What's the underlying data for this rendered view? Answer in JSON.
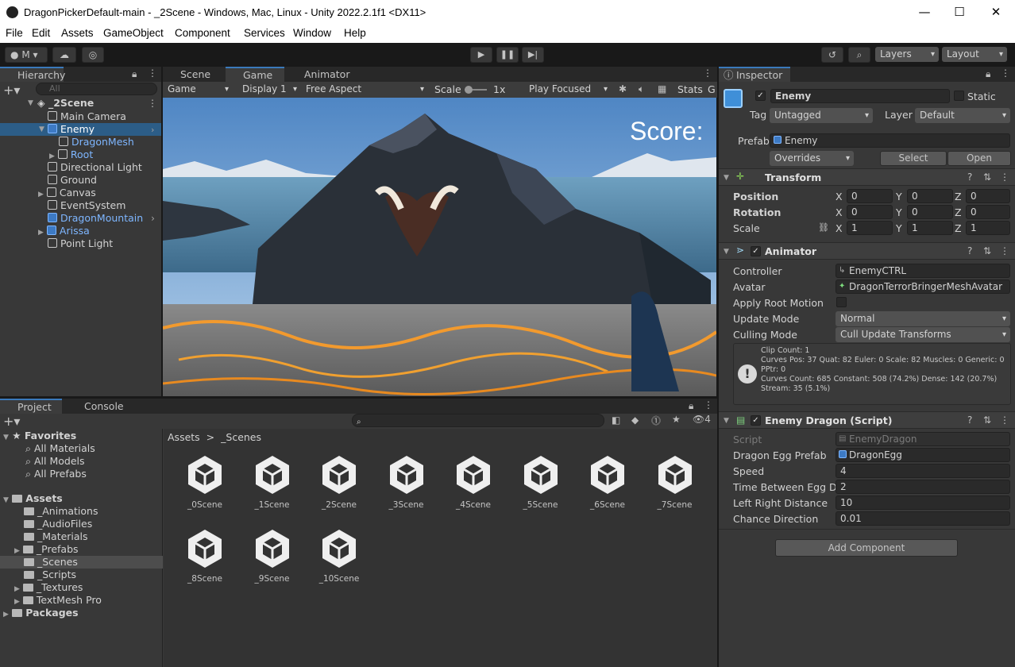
{
  "window": {
    "title": "DragonPickerDefault-main - _2Scene - Windows, Mac, Linux - Unity 2022.2.1f1 <DX11>",
    "minimize": "—",
    "maximize": "☐",
    "close": "✕"
  },
  "menu": [
    "File",
    "Edit",
    "Assets",
    "GameObject",
    "Component",
    "Services",
    "Window",
    "Help"
  ],
  "toolbar": {
    "account": "M",
    "layers": "Layers",
    "layout": "Layout"
  },
  "hierarchy": {
    "tab": "Hierarchy",
    "search_placeholder": "All",
    "scene": "_2Scene",
    "items": [
      {
        "label": "Main Camera"
      },
      {
        "label": "Enemy"
      },
      {
        "label": "DragonMesh"
      },
      {
        "label": "Root"
      },
      {
        "label": "Directional Light"
      },
      {
        "label": "Ground"
      },
      {
        "label": "Canvas"
      },
      {
        "label": "EventSystem"
      },
      {
        "label": "DragonMountain"
      },
      {
        "label": "Arissa"
      },
      {
        "label": "Point Light"
      }
    ]
  },
  "center_tabs": [
    "Scene",
    "Game",
    "Animator"
  ],
  "game_toolbar": {
    "mode": "Game",
    "display": "Display 1",
    "aspect": "Free Aspect",
    "scale_label": "Scale",
    "scale_value": "1x",
    "play_focused": "Play Focused",
    "stats": "Stats",
    "gizmos": "G"
  },
  "game_view": {
    "score_text": "Score:"
  },
  "project": {
    "tabs": [
      "Project",
      "Console"
    ],
    "hidden_count": "4",
    "breadcrumb_root": "Assets",
    "breadcrumb_sep": ">",
    "breadcrumb_current": "_Scenes",
    "favorites_label": "Favorites",
    "favorites": [
      "All Materials",
      "All Models",
      "All Prefabs"
    ],
    "assets_label": "Assets",
    "folders": [
      "_Animations",
      "_AudioFiles",
      "_Materials",
      "_Prefabs",
      "_Scenes",
      "_Scripts",
      "_Textures",
      "TextMesh Pro"
    ],
    "packages_label": "Packages",
    "scenes": [
      "_0Scene",
      "_1Scene",
      "_2Scene",
      "_3Scene",
      "_4Scene",
      "_5Scene",
      "_6Scene",
      "_7Scene",
      "_8Scene",
      "_9Scene",
      "_10Scene"
    ]
  },
  "inspector": {
    "tab": "Inspector",
    "object_name": "Enemy",
    "static_label": "Static",
    "tag_label": "Tag",
    "tag_value": "Untagged",
    "layer_label": "Layer",
    "layer_value": "Default",
    "prefab_label": "Prefab",
    "prefab_value": "Enemy",
    "overrides": "Overrides",
    "select": "Select",
    "open": "Open",
    "transform": {
      "title": "Transform",
      "position_label": "Position",
      "rotation_label": "Rotation",
      "scale_label": "Scale",
      "position": [
        "0",
        "0",
        "0"
      ],
      "rotation": [
        "0",
        "0",
        "0"
      ],
      "scale": [
        "1",
        "1",
        "1"
      ],
      "axes": [
        "X",
        "Y",
        "Z"
      ]
    },
    "animator": {
      "title": "Animator",
      "controller_label": "Controller",
      "controller_value": "EnemyCTRL",
      "avatar_label": "Avatar",
      "avatar_value": "DragonTerrorBringerMeshAvatar",
      "root_motion_label": "Apply Root Motion",
      "update_mode_label": "Update Mode",
      "update_mode_value": "Normal",
      "culling_mode_label": "Culling Mode",
      "culling_mode_value": "Cull Update Transforms",
      "info_lines": [
        "Clip Count: 1",
        "Curves Pos: 37 Quat: 82 Euler: 0 Scale: 82 Muscles: 0 Generic: 0",
        "PPtr: 0",
        "Curves Count: 685 Constant: 508 (74.2%) Dense: 142 (20.7%)",
        "Stream: 35 (5.1%)"
      ]
    },
    "script": {
      "title": "Enemy Dragon (Script)",
      "script_label": "Script",
      "script_value": "EnemyDragon",
      "egg_label": "Dragon Egg Prefab",
      "egg_value": "DragonEgg",
      "speed_label": "Speed",
      "speed_value": "4",
      "tbe_label": "Time Between Egg Drc",
      "tbe_value": "2",
      "lrd_label": "Left Right Distance",
      "lrd_value": "10",
      "chance_label": "Chance Direction",
      "chance_value": "0.01"
    },
    "add_component": "Add Component"
  }
}
